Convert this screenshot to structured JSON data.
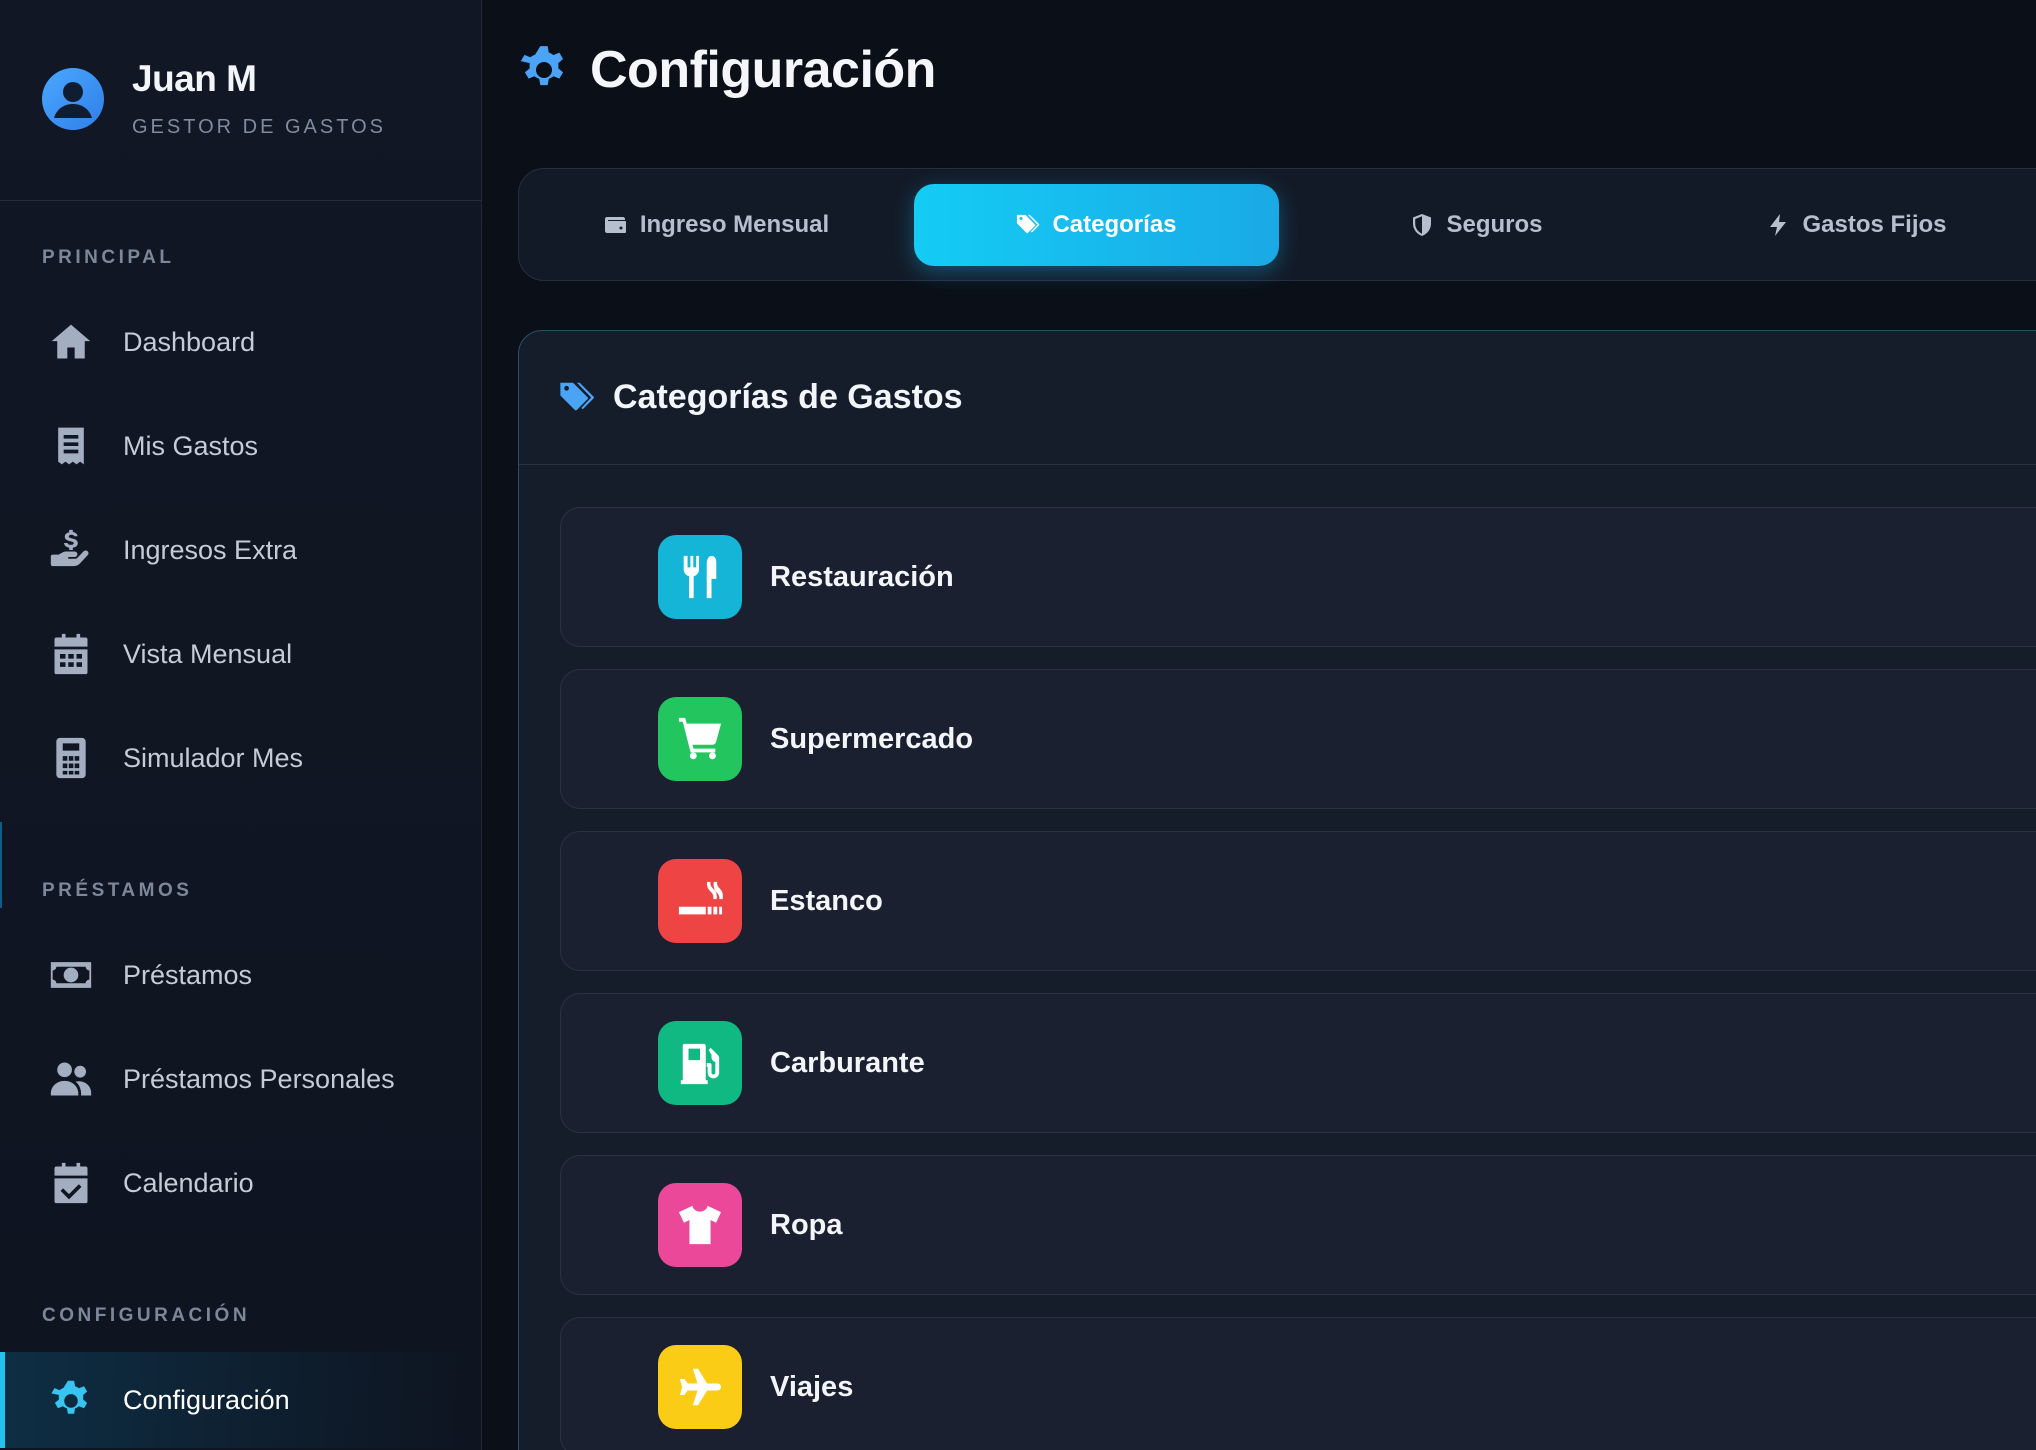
{
  "profile": {
    "name": "Juan M",
    "role": "GESTOR DE GASTOS"
  },
  "sidebar": {
    "sections": [
      {
        "title": "PRINCIPAL"
      },
      {
        "title": "PRÉSTAMOS"
      },
      {
        "title": "CONFIGURACIÓN"
      }
    ],
    "items": [
      {
        "label": "Dashboard",
        "icon": "home-icon"
      },
      {
        "label": "Mis Gastos",
        "icon": "receipt-icon"
      },
      {
        "label": "Ingresos Extra",
        "icon": "hand-dollar-icon"
      },
      {
        "label": "Vista Mensual",
        "icon": "calendar-grid-icon"
      },
      {
        "label": "Simulador Mes",
        "icon": "calculator-icon"
      },
      {
        "label": "Préstamos",
        "icon": "money-bill-icon"
      },
      {
        "label": "Préstamos Personales",
        "icon": "users-icon"
      },
      {
        "label": "Calendario",
        "icon": "calendar-check-icon"
      },
      {
        "label": "Configuración",
        "icon": "gear-icon",
        "active": true
      }
    ]
  },
  "page": {
    "title": "Configuración"
  },
  "tabs": [
    {
      "label": "Ingreso Mensual",
      "icon": "wallet-icon"
    },
    {
      "label": "Categorías",
      "icon": "tags-icon",
      "active": true
    },
    {
      "label": "Seguros",
      "icon": "shield-icon"
    },
    {
      "label": "Gastos Fijos",
      "icon": "bolt-icon"
    }
  ],
  "panel": {
    "title": "Categorías de Gastos",
    "categories": [
      {
        "label": "Restauración",
        "icon": "utensils-icon",
        "color": "#14b5d6"
      },
      {
        "label": "Supermercado",
        "icon": "cart-icon",
        "color": "#22c55e"
      },
      {
        "label": "Estanco",
        "icon": "smoking-icon",
        "color": "#ef4444"
      },
      {
        "label": "Carburante",
        "icon": "gas-pump-icon",
        "color": "#10b981"
      },
      {
        "label": "Ropa",
        "icon": "shirt-icon",
        "color": "#ec4899"
      },
      {
        "label": "Viajes",
        "icon": "plane-icon",
        "color": "#facc15"
      }
    ]
  }
}
